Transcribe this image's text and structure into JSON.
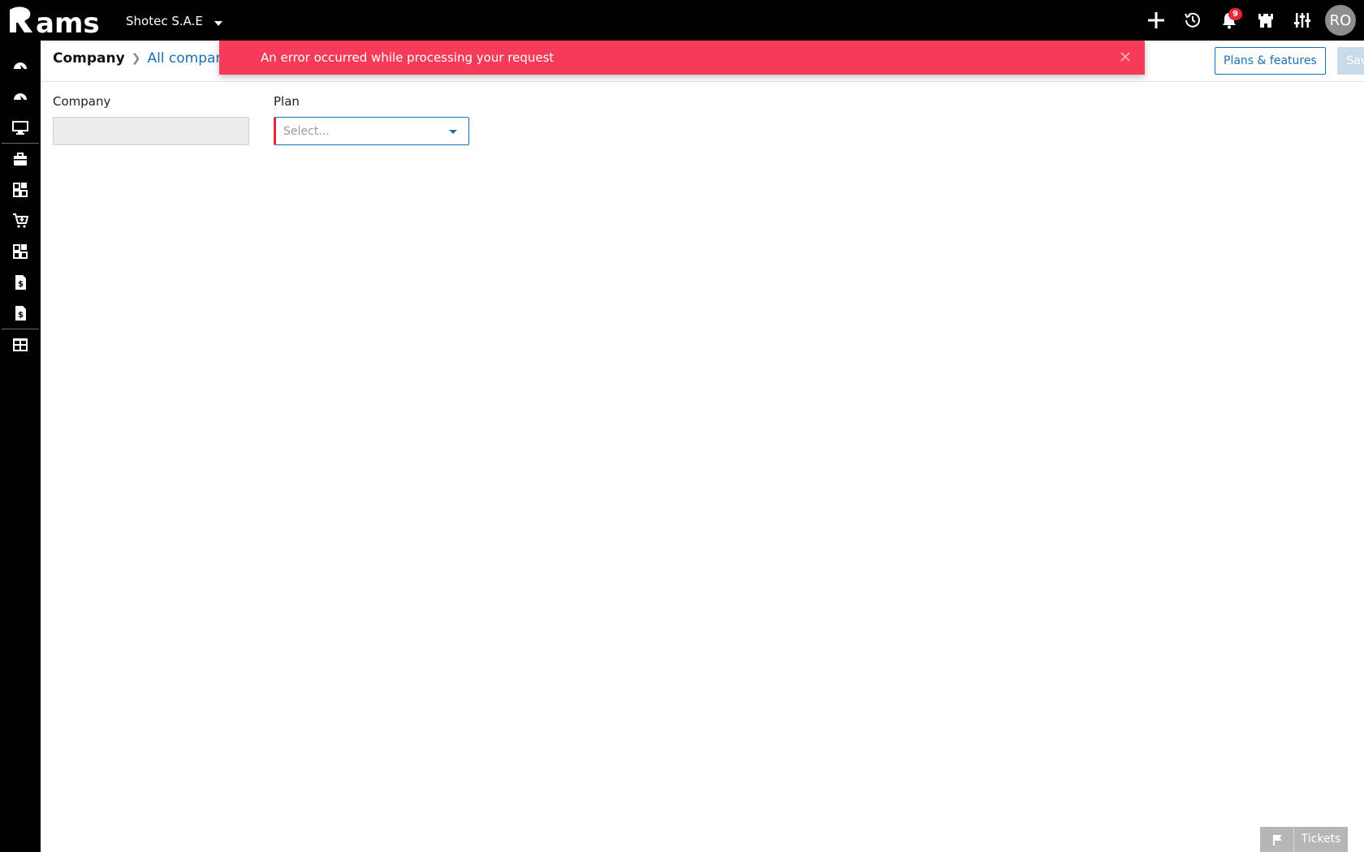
{
  "app": {
    "logo_text": "Rams"
  },
  "topbar": {
    "company_name": "Shotec S.A.E",
    "notifications_count": "9",
    "avatar_initials": "RO"
  },
  "breadcrumb": {
    "current": "Company",
    "link": "All companies"
  },
  "toolbar": {
    "plans_label": "Plans & features",
    "save_label": "Save"
  },
  "toast": {
    "message": "An error occurred while processing your request"
  },
  "form": {
    "company_label": "Company",
    "company_value": "",
    "plan_label": "Plan",
    "plan_placeholder": "Select..."
  },
  "tickets": {
    "label": "Tickets"
  },
  "colors": {
    "accent": "#1a6fb5",
    "error": "#f53b57",
    "sidebar": "#000000"
  },
  "icons": {
    "topbar": [
      "plus-icon",
      "history-icon",
      "bell-icon",
      "castle-icon",
      "sliders-icon"
    ],
    "sidebar": [
      "dashboard-icon",
      "dashboard-icon-2",
      "monitor-icon",
      "briefcase-icon",
      "widgets-icon",
      "cart-icon",
      "widgets-icon-2",
      "invoice-icon",
      "invoice-icon-2",
      "table-icon"
    ]
  }
}
